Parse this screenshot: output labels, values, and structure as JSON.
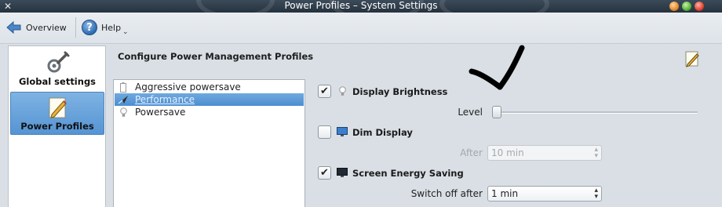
{
  "window": {
    "title": "Power Profiles – System Settings"
  },
  "toolbar": {
    "overview_label": "Overview",
    "help_label": "Help"
  },
  "sidebar": {
    "items": [
      {
        "label": "Global settings",
        "icon": "wrench-gear-icon",
        "selected": false
      },
      {
        "label": "Power Profiles",
        "icon": "pencil-document-icon",
        "selected": true
      }
    ]
  },
  "main": {
    "heading": "Configure Power Management Profiles",
    "profiles": [
      {
        "label": "Aggressive powersave",
        "icon": "battery-icon",
        "selected": false
      },
      {
        "label": "Performance",
        "icon": "rocket-icon",
        "selected": true
      },
      {
        "label": "Powersave",
        "icon": "lightbulb-icon",
        "selected": false
      }
    ],
    "display_brightness": {
      "label": "Display Brightness",
      "checked": true,
      "level_label": "Level",
      "level_value": 0.0
    },
    "dim_display": {
      "label": "Dim Display",
      "checked": false,
      "after_label": "After",
      "after_value": "10 min"
    },
    "screen_energy_saving": {
      "label": "Screen Energy Saving",
      "checked": true,
      "switch_off_label": "Switch off after",
      "switch_off_value": "1 min"
    }
  },
  "colors": {
    "selection": "#5594d3",
    "titlebar": "#2f3d4b",
    "annotation": "#000000"
  }
}
